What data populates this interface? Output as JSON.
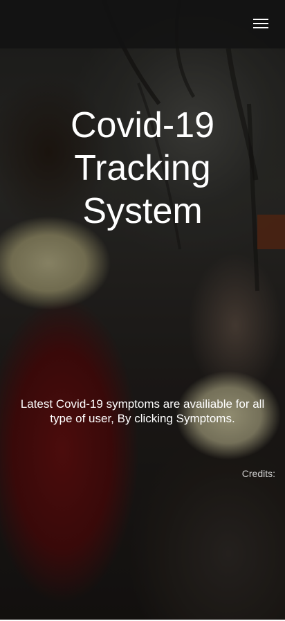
{
  "navbar": {
    "menu_icon": "hamburger-menu-icon"
  },
  "hero": {
    "title_line1": "Covid-19",
    "title_line2": "Tracking",
    "title_line3": "System",
    "tagline": "Latest Covid-19 symptoms are availiable for all type of user, By clicking Symptoms.",
    "credits_label": "Credits:"
  },
  "colors": {
    "navbar_bg": "#121212",
    "text": "#ffffff",
    "credits_text": "#cfcfcf"
  }
}
